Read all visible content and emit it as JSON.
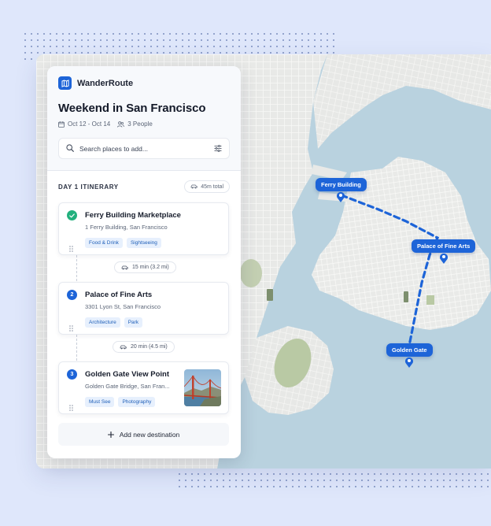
{
  "app": {
    "name": "WanderRoute",
    "logo_icon": "map-icon"
  },
  "trip": {
    "title": "Weekend in San Francisco",
    "dates": "Oct 12 - Oct 14",
    "people": "3 People"
  },
  "search": {
    "placeholder": "Search places to add..."
  },
  "day": {
    "title": "DAY 1 ITINERARY",
    "total": "45m total"
  },
  "stops": [
    {
      "number": "",
      "status": "completed",
      "name": "Ferry Building Marketplace",
      "address": "1 Ferry Building, San Francisco",
      "tags": [
        "Food & Drink",
        "Sightseeing"
      ]
    },
    {
      "number": "2",
      "status": "upcoming",
      "name": "Palace of Fine Arts",
      "address": "3301 Lyon St, San Francisco",
      "tags": [
        "Architecture",
        "Park"
      ]
    },
    {
      "number": "3",
      "status": "upcoming",
      "name": "Golden Gate View Point",
      "address": "Golden Gate Bridge, San Fran...",
      "tags": [
        "Must See",
        "Photography"
      ]
    }
  ],
  "travel": [
    {
      "label": "15 min (3.2 mi)"
    },
    {
      "label": "20 min (4.5 mi)"
    }
  ],
  "add_destination": "Add new destination",
  "map": {
    "pins": [
      {
        "label": "Ferry Building"
      },
      {
        "label": "Palace of Fine Arts"
      },
      {
        "label": "Golden Gate"
      }
    ]
  },
  "colors": {
    "accent": "#1d64d8",
    "completed": "#22b07d",
    "water": "#b8d3e0",
    "land": "#e9eae8",
    "park": "#b9c9a4",
    "background": "#dfe7fb"
  }
}
